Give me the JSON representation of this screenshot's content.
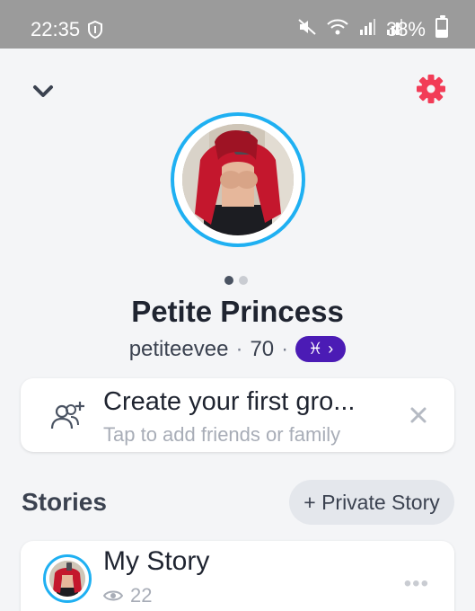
{
  "status_bar": {
    "time": "22:35",
    "battery_percent": "38%",
    "battery_level": 0.38,
    "icons": [
      "shield-icon",
      "mute-icon",
      "wifi-icon",
      "signal-icon",
      "signal-icon",
      "battery-icon"
    ]
  },
  "header": {
    "back_icon": "chevron-down-icon",
    "settings_icon": "gear-icon",
    "accent_color": "#f23c57"
  },
  "profile": {
    "display_name": "Petite Princess",
    "username": "petiteevee",
    "score": "70",
    "separator": "·",
    "zodiac_symbol": "♓",
    "zodiac_chevron": "›",
    "ring_color": "#1fb0f2",
    "zodiac_color": "#4b1bb5",
    "page_dots": {
      "count": 2,
      "active": 1
    }
  },
  "group_prompt": {
    "title": "Create your first gro...",
    "subtitle": "Tap to add friends or family",
    "icon": "add-group-icon",
    "close_icon": "close-icon"
  },
  "stories": {
    "section_title": "Stories",
    "private_story_button": "+ Private Story",
    "items": [
      {
        "title": "My Story",
        "views": "22",
        "views_icon": "eye-icon",
        "more_icon": "more-icon"
      }
    ]
  }
}
